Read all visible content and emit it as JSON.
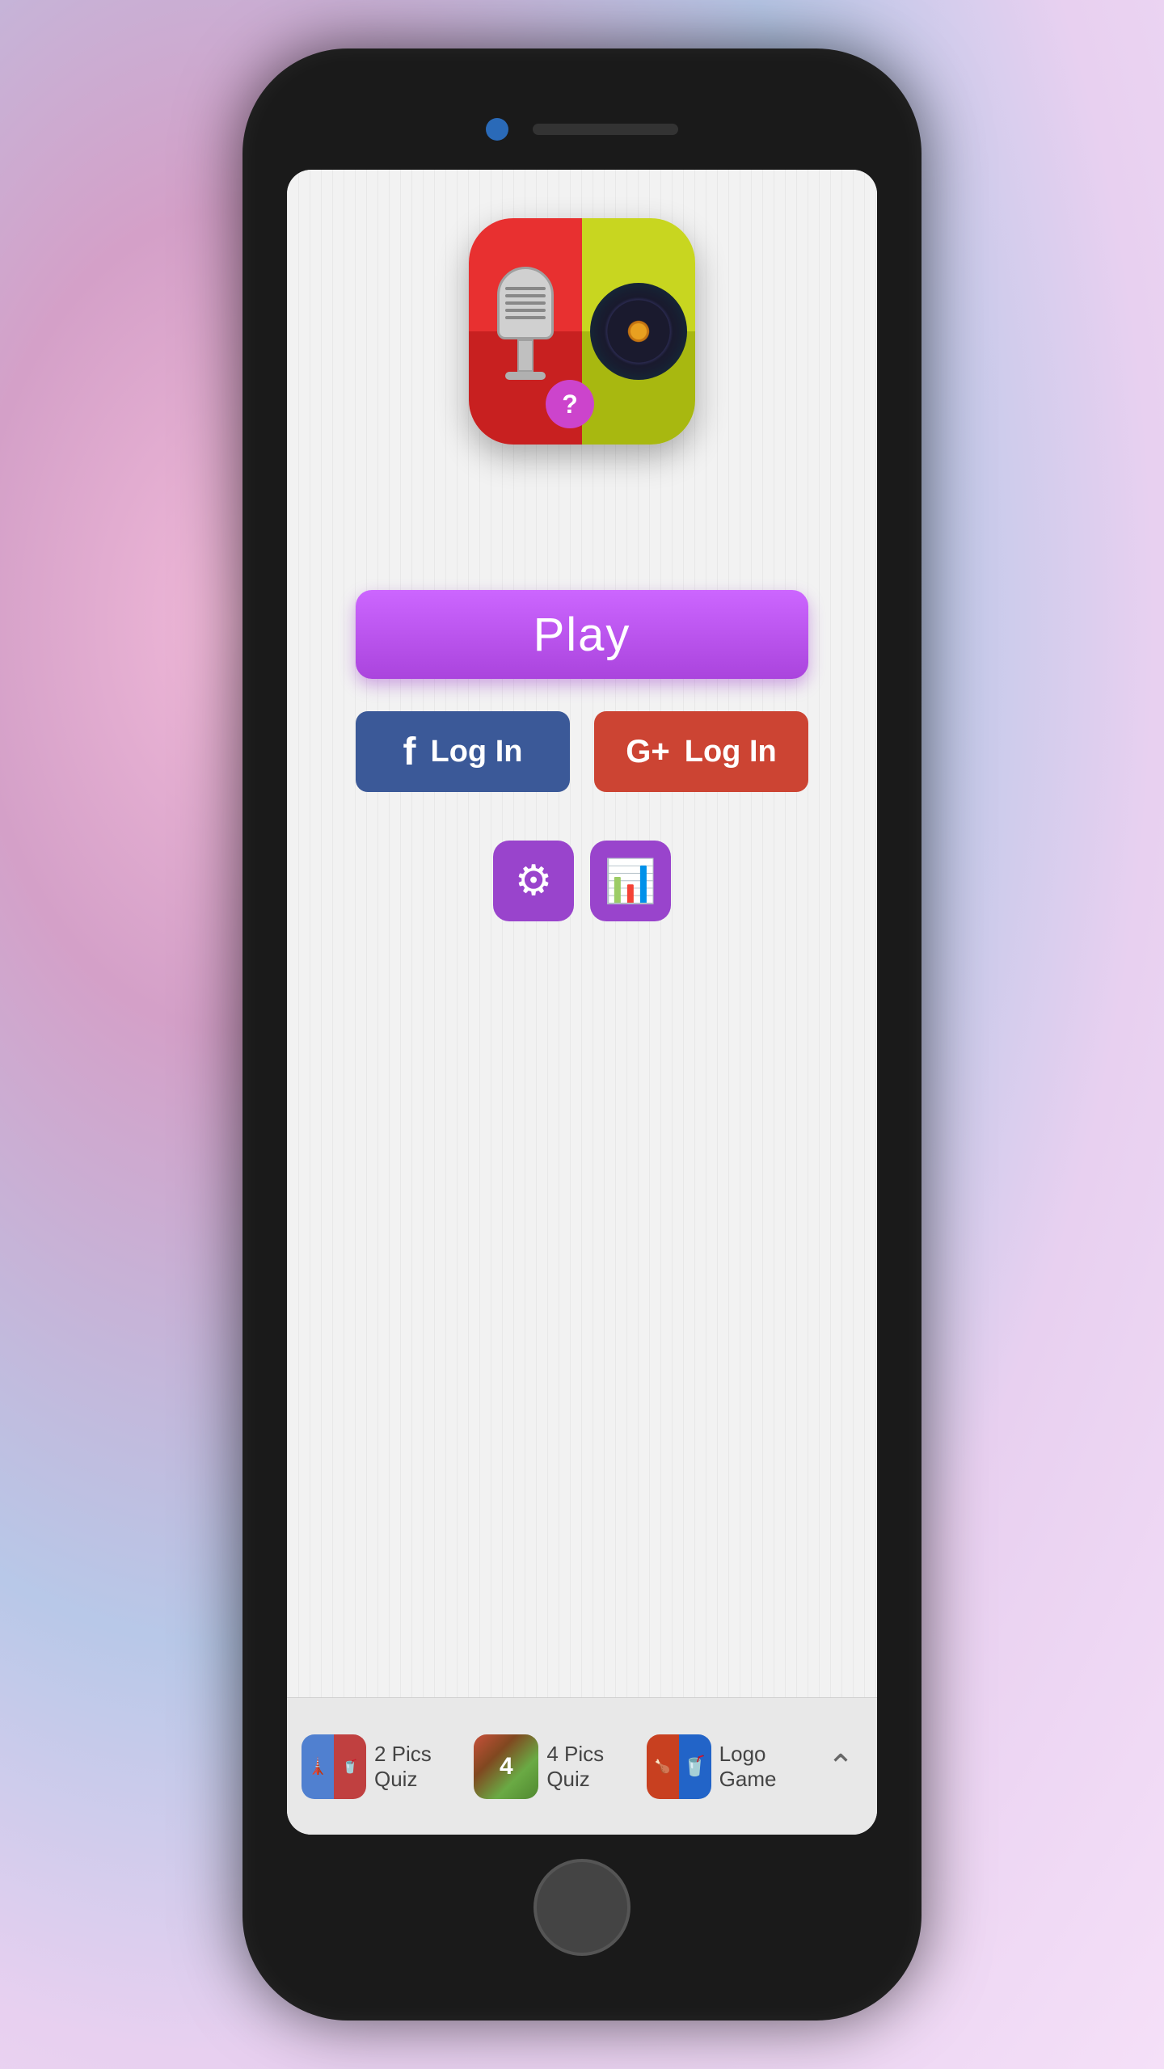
{
  "phone": {
    "camera_alt": "front camera",
    "speaker_alt": "speaker"
  },
  "app": {
    "icon_alt": "Music Quiz App Icon"
  },
  "buttons": {
    "play_label": "Play",
    "facebook_login_label": "Log In",
    "google_login_label": "Log In",
    "settings_icon": "⚙",
    "stats_icon": "📊"
  },
  "bottom_bar": {
    "apps": [
      {
        "label": "2 Pics Quiz",
        "id": "2pics"
      },
      {
        "label": "4 Pics Quiz",
        "id": "4pics"
      },
      {
        "label": "Logo Game",
        "id": "logo"
      }
    ],
    "expand_label": "^"
  },
  "colors": {
    "play_btn": "#bb55ee",
    "facebook_btn": "#3b5998",
    "google_btn": "#cc4433",
    "settings_btn": "#9944cc",
    "stats_btn": "#9944cc"
  }
}
